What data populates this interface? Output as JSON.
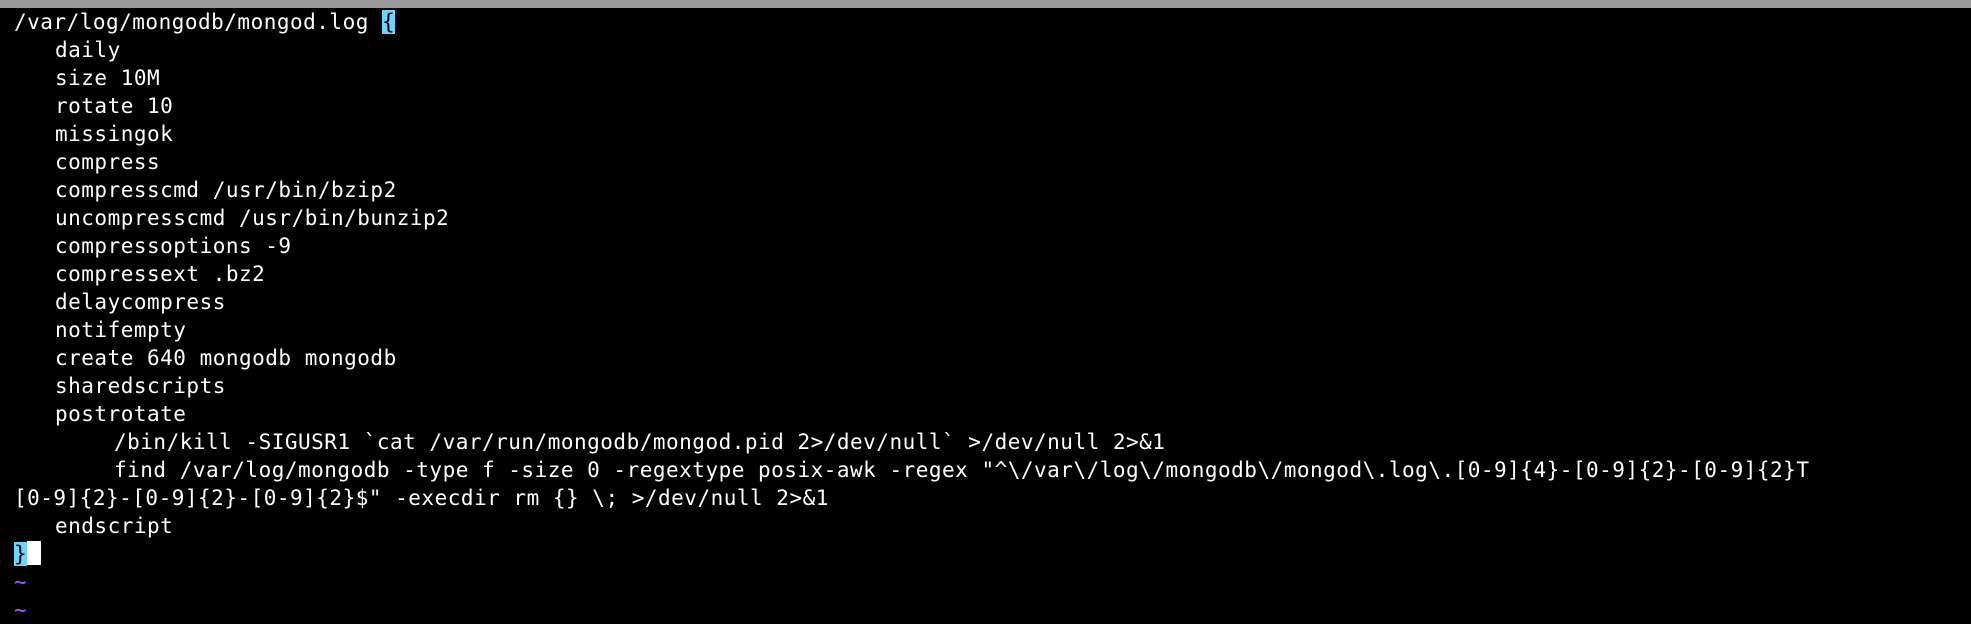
{
  "window": {
    "title_bar_color": "#9a9a9a"
  },
  "editor": {
    "header_path": "/var/log/mongodb/mongod.log ",
    "open_brace": "{",
    "directives": [
      "daily",
      "size 10M",
      "rotate 10",
      "missingok",
      "compress",
      "compresscmd /usr/bin/bzip2",
      "uncompresscmd /usr/bin/bunzip2",
      "compressoptions -9",
      "compressext .bz2",
      "delaycompress",
      "notifempty",
      "create 640 mongodb mongodb",
      "sharedscripts",
      "postrotate"
    ],
    "script_lines": [
      "/bin/kill -SIGUSR1 `cat /var/run/mongodb/mongod.pid 2>/dev/null` >/dev/null 2>&1",
      "find /var/log/mongodb -type f -size 0 -regextype posix-awk -regex \"^\\/var\\/log\\/mongodb\\/mongod\\.log\\.[0-9]{4}-[0-9]{2}-[0-9]{2}T"
    ],
    "wrapped_line": "[0-9]{2}-[0-9]{2}-[0-9]{2}$\" -execdir rm {} \\; >/dev/null 2>&1",
    "endscript": "endscript",
    "close_brace": "}",
    "empty_markers": [
      "~",
      "~"
    ],
    "colors": {
      "background": "#000000",
      "text": "#ffffff",
      "brace_highlight": "#6fd3ff",
      "tilde": "#9b59ff",
      "cursor": "#ffffff"
    }
  }
}
